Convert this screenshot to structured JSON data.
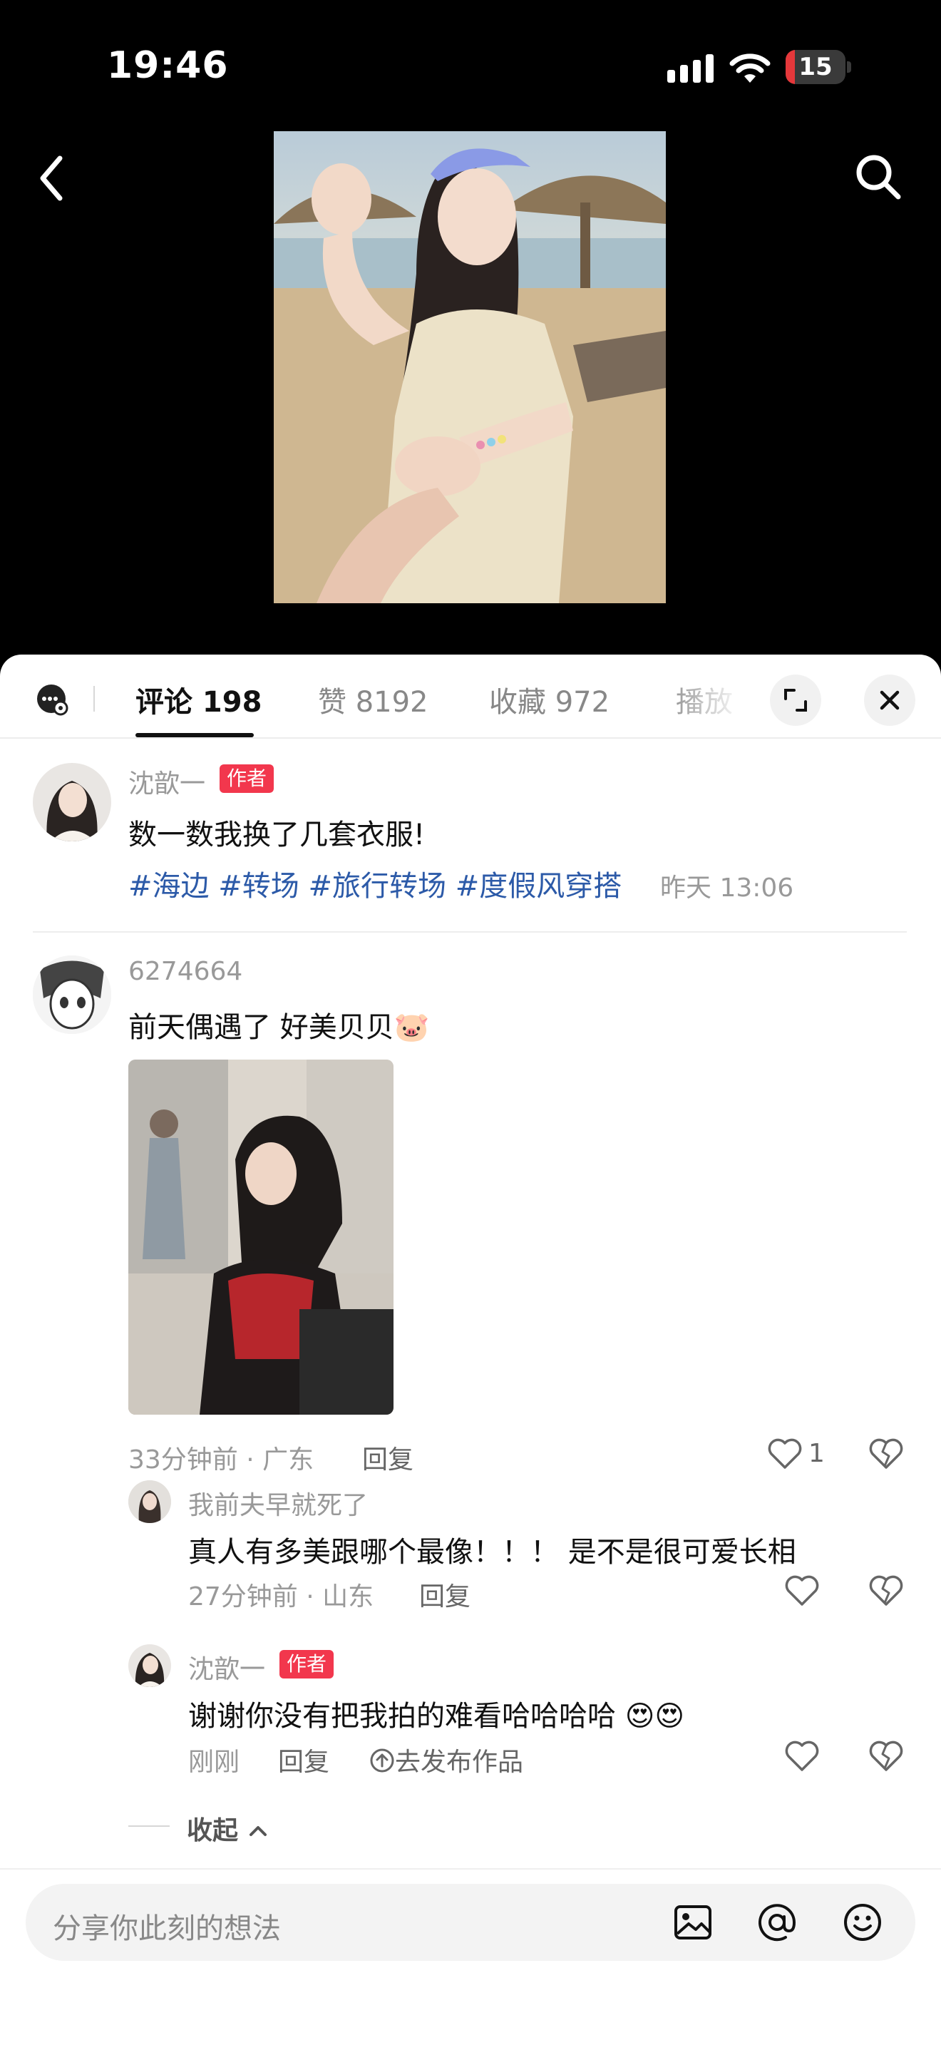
{
  "status_bar": {
    "time": "19:46",
    "battery": "15",
    "battery_fraction": 0.15
  },
  "tabs": [
    {
      "label": "评论 198"
    },
    {
      "label": "赞 8192"
    },
    {
      "label": "收藏 972"
    },
    {
      "label": "播放"
    }
  ],
  "post": {
    "author_name": "沈歆一",
    "author_tag": "作者",
    "text": "数一数我换了几套衣服!",
    "hashtags": [
      "#海边",
      "#转场",
      "#旅行转场",
      "#度假风穿搭"
    ],
    "time": "昨天 13:06"
  },
  "comment": {
    "user": "6274664",
    "text": "前天偶遇了 好美贝贝",
    "emoji": "🐷",
    "meta": "33分钟前 · 广东",
    "reply_label": "回复",
    "like_count": "1"
  },
  "replies": [
    {
      "user": "我前夫早就死了",
      "text": "真人有多美跟哪个最像！！！ 是不是很可爱长相",
      "meta": "27分钟前 · 山东",
      "reply_label": "回复"
    },
    {
      "user": "沈歆一",
      "tag": "作者",
      "text": "谢谢你没有把我拍的难看哈哈哈哈",
      "emoji": "😍😍",
      "meta": "刚刚",
      "reply_label": "回复",
      "share_label": "去发布作品"
    }
  ],
  "collapse_label": "收起",
  "input": {
    "placeholder": "分享你此刻的想法"
  },
  "colors": {
    "hashtag": "#2c5aa8",
    "author_tag": "#f2374d"
  },
  "icons": [
    "back-icon",
    "search-icon",
    "comment-settings-icon",
    "expand-icon",
    "close-icon",
    "heart-icon",
    "dislike-icon",
    "image-icon",
    "at-icon",
    "emoji-icon",
    "share-up-icon",
    "chevron-up-icon"
  ]
}
